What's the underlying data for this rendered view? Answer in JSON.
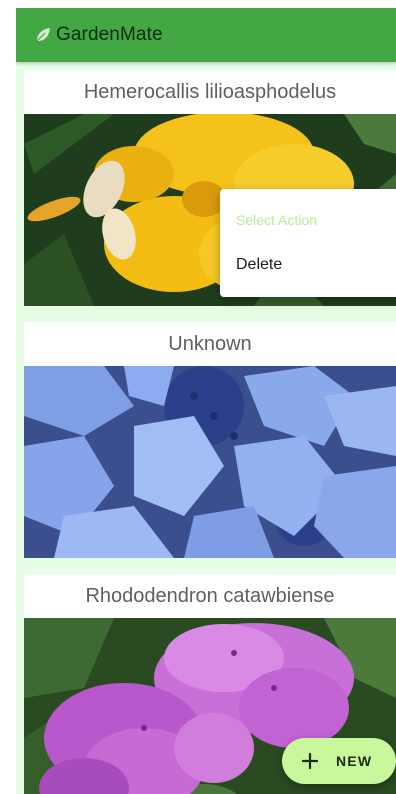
{
  "app": {
    "title": "GardenMate",
    "brand_color": "#43a843",
    "background_color": "#e6fce5",
    "logo_icon": "leaf-icon"
  },
  "cards": [
    {
      "title": "Hemerocallis lilioasphodelus",
      "photo": "yellow-daylily-photo"
    },
    {
      "title": "Unknown",
      "photo": "blue-hydrangea-photo"
    },
    {
      "title": "Rhododendron catawbiense",
      "photo": "purple-rhododendron-photo"
    }
  ],
  "context_menu": {
    "header": "Select Action",
    "items": [
      {
        "label": "Delete"
      }
    ]
  },
  "fab": {
    "label": "NEW",
    "icon": "plus-icon",
    "color": "#c9f79c"
  }
}
